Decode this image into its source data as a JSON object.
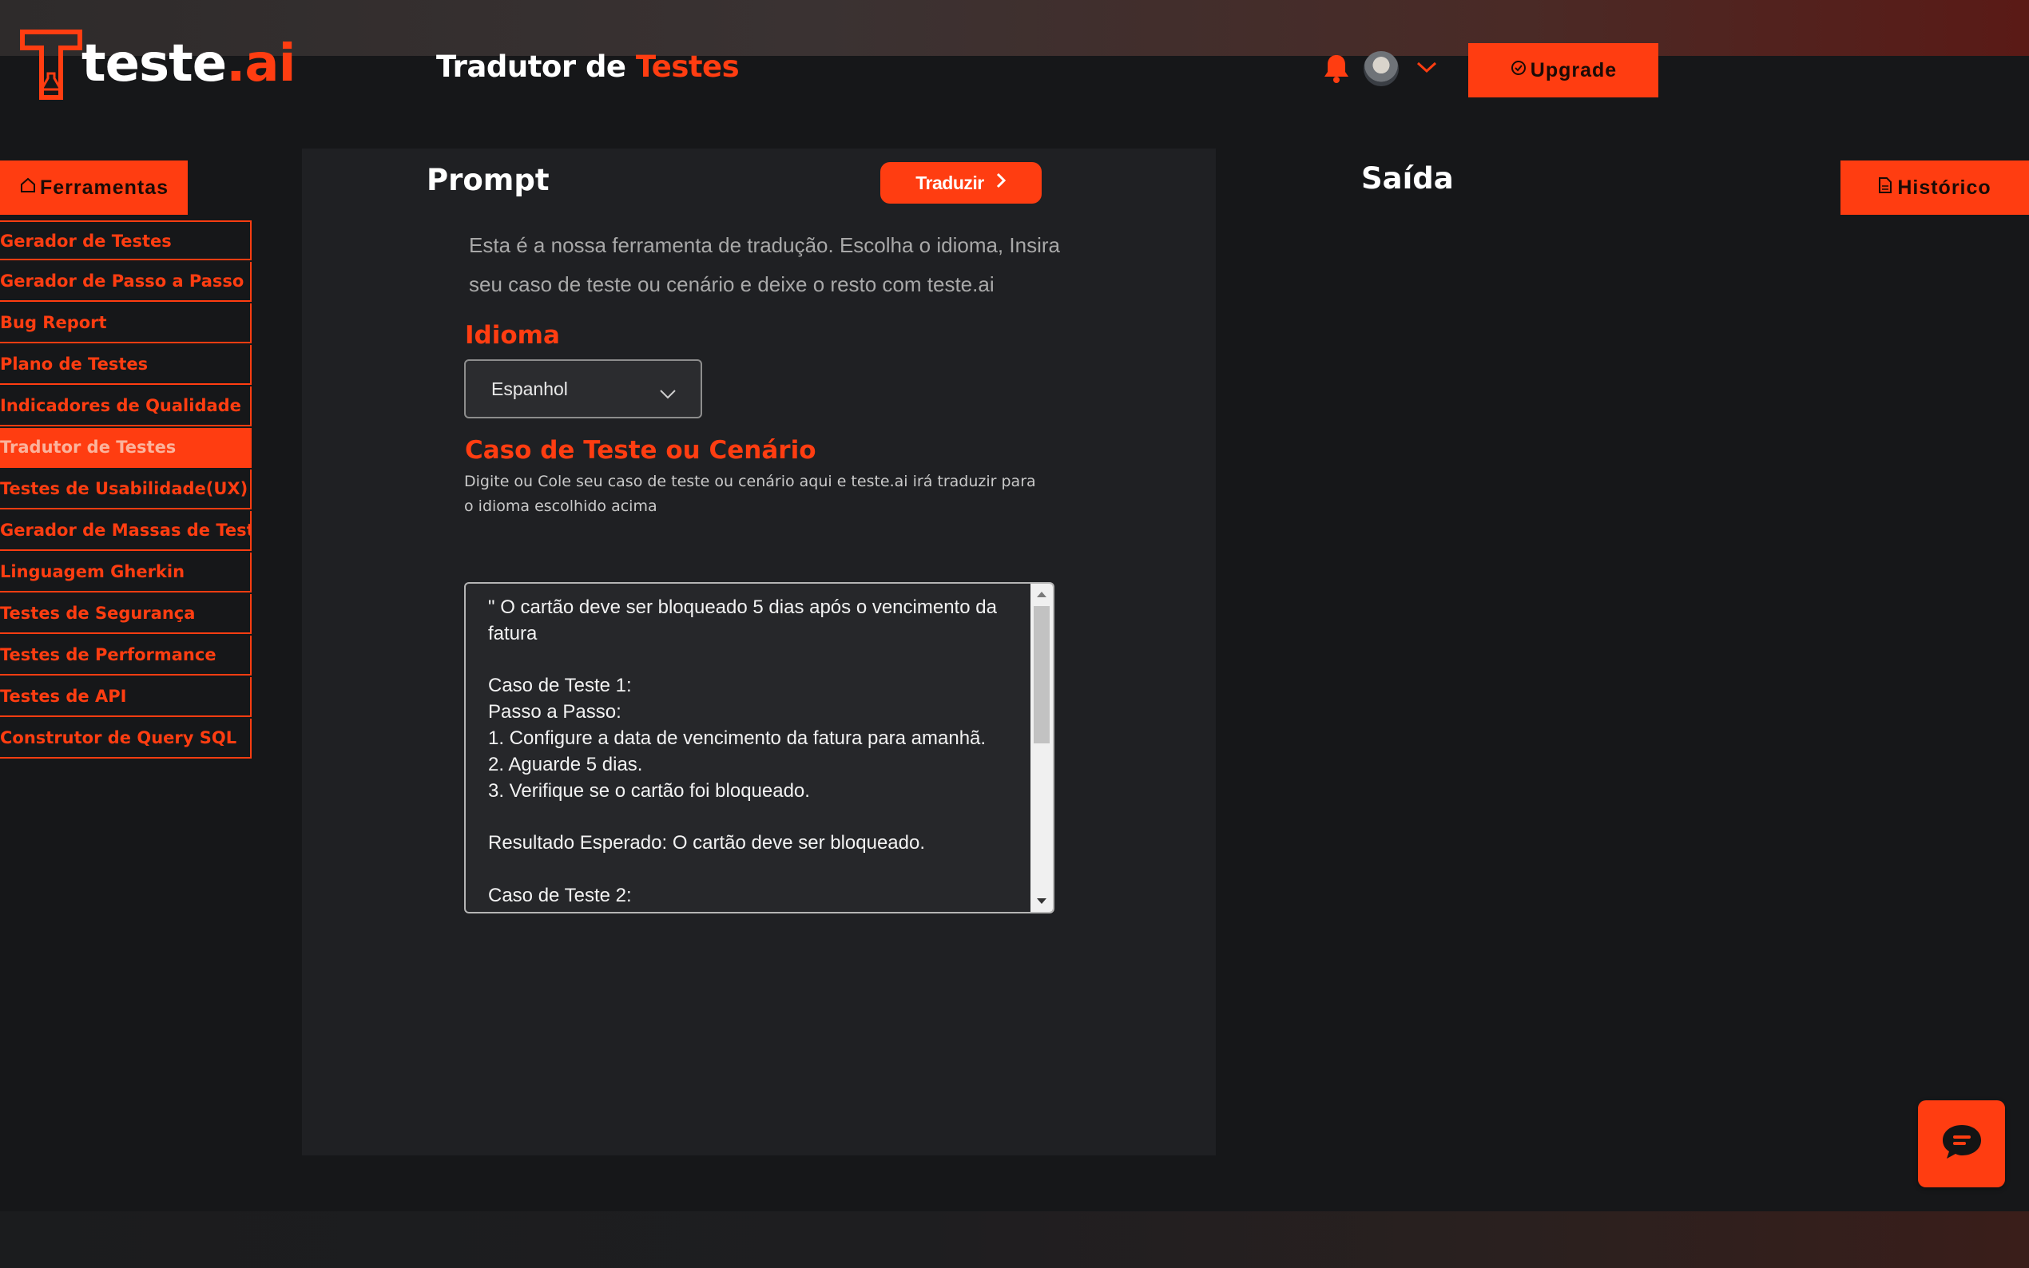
{
  "brand": {
    "logo_text": "teste",
    "logo_accent": ".ai"
  },
  "header": {
    "title_part1": "Tradutor de ",
    "title_part2": "Testes",
    "upgrade_label": "Upgrade"
  },
  "sidebar": {
    "tools_label": "Ferramentas",
    "items": [
      {
        "label": "Gerador de Testes"
      },
      {
        "label": "Gerador de Passo a Passo"
      },
      {
        "label": "Bug Report"
      },
      {
        "label": "Plano de Testes"
      },
      {
        "label": "Indicadores de Qualidade"
      },
      {
        "label": "Tradutor de Testes",
        "active": true
      },
      {
        "label": "Testes de Usabilidade(UX)"
      },
      {
        "label": "Gerador de Massas de Teste"
      },
      {
        "label": "Linguagem Gherkin"
      },
      {
        "label": "Testes de Segurança"
      },
      {
        "label": "Testes de Performance"
      },
      {
        "label": "Testes de API"
      },
      {
        "label": "Construtor de Query SQL"
      }
    ]
  },
  "prompt": {
    "title": "Prompt",
    "translate_label": "Traduzir",
    "intro": "Esta é a nossa ferramenta de tradução. Escolha o idioma, Insira seu caso de teste ou cenário e deixe o resto com teste.ai",
    "language_label": "Idioma",
    "language_value": "Espanhol",
    "case_label": "Caso de Teste ou Cenário",
    "case_hint": "Digite ou Cole seu caso de teste ou cenário aqui e teste.ai irá traduzir para o idioma escolhido acima",
    "case_text": "\" O cartão deve ser bloqueado 5 dias após o vencimento da fatura\n\nCaso de Teste 1:\nPasso a Passo:\n1. Configure a data de vencimento da fatura para amanhã.\n2. Aguarde 5 dias.\n3. Verifique se o cartão foi bloqueado.\n\nResultado Esperado: O cartão deve ser bloqueado.\n\nCaso de Teste 2:"
  },
  "output": {
    "title": "Saída",
    "history_label": "Histórico"
  },
  "colors": {
    "accent": "#ff3d11",
    "background": "#161719",
    "panel": "#1f2023"
  },
  "icons": [
    "bell-icon",
    "avatar",
    "chevron-down-icon",
    "upgrade-badge-icon",
    "home-icon",
    "chevron-right-icon",
    "document-icon",
    "chat-icon"
  ]
}
